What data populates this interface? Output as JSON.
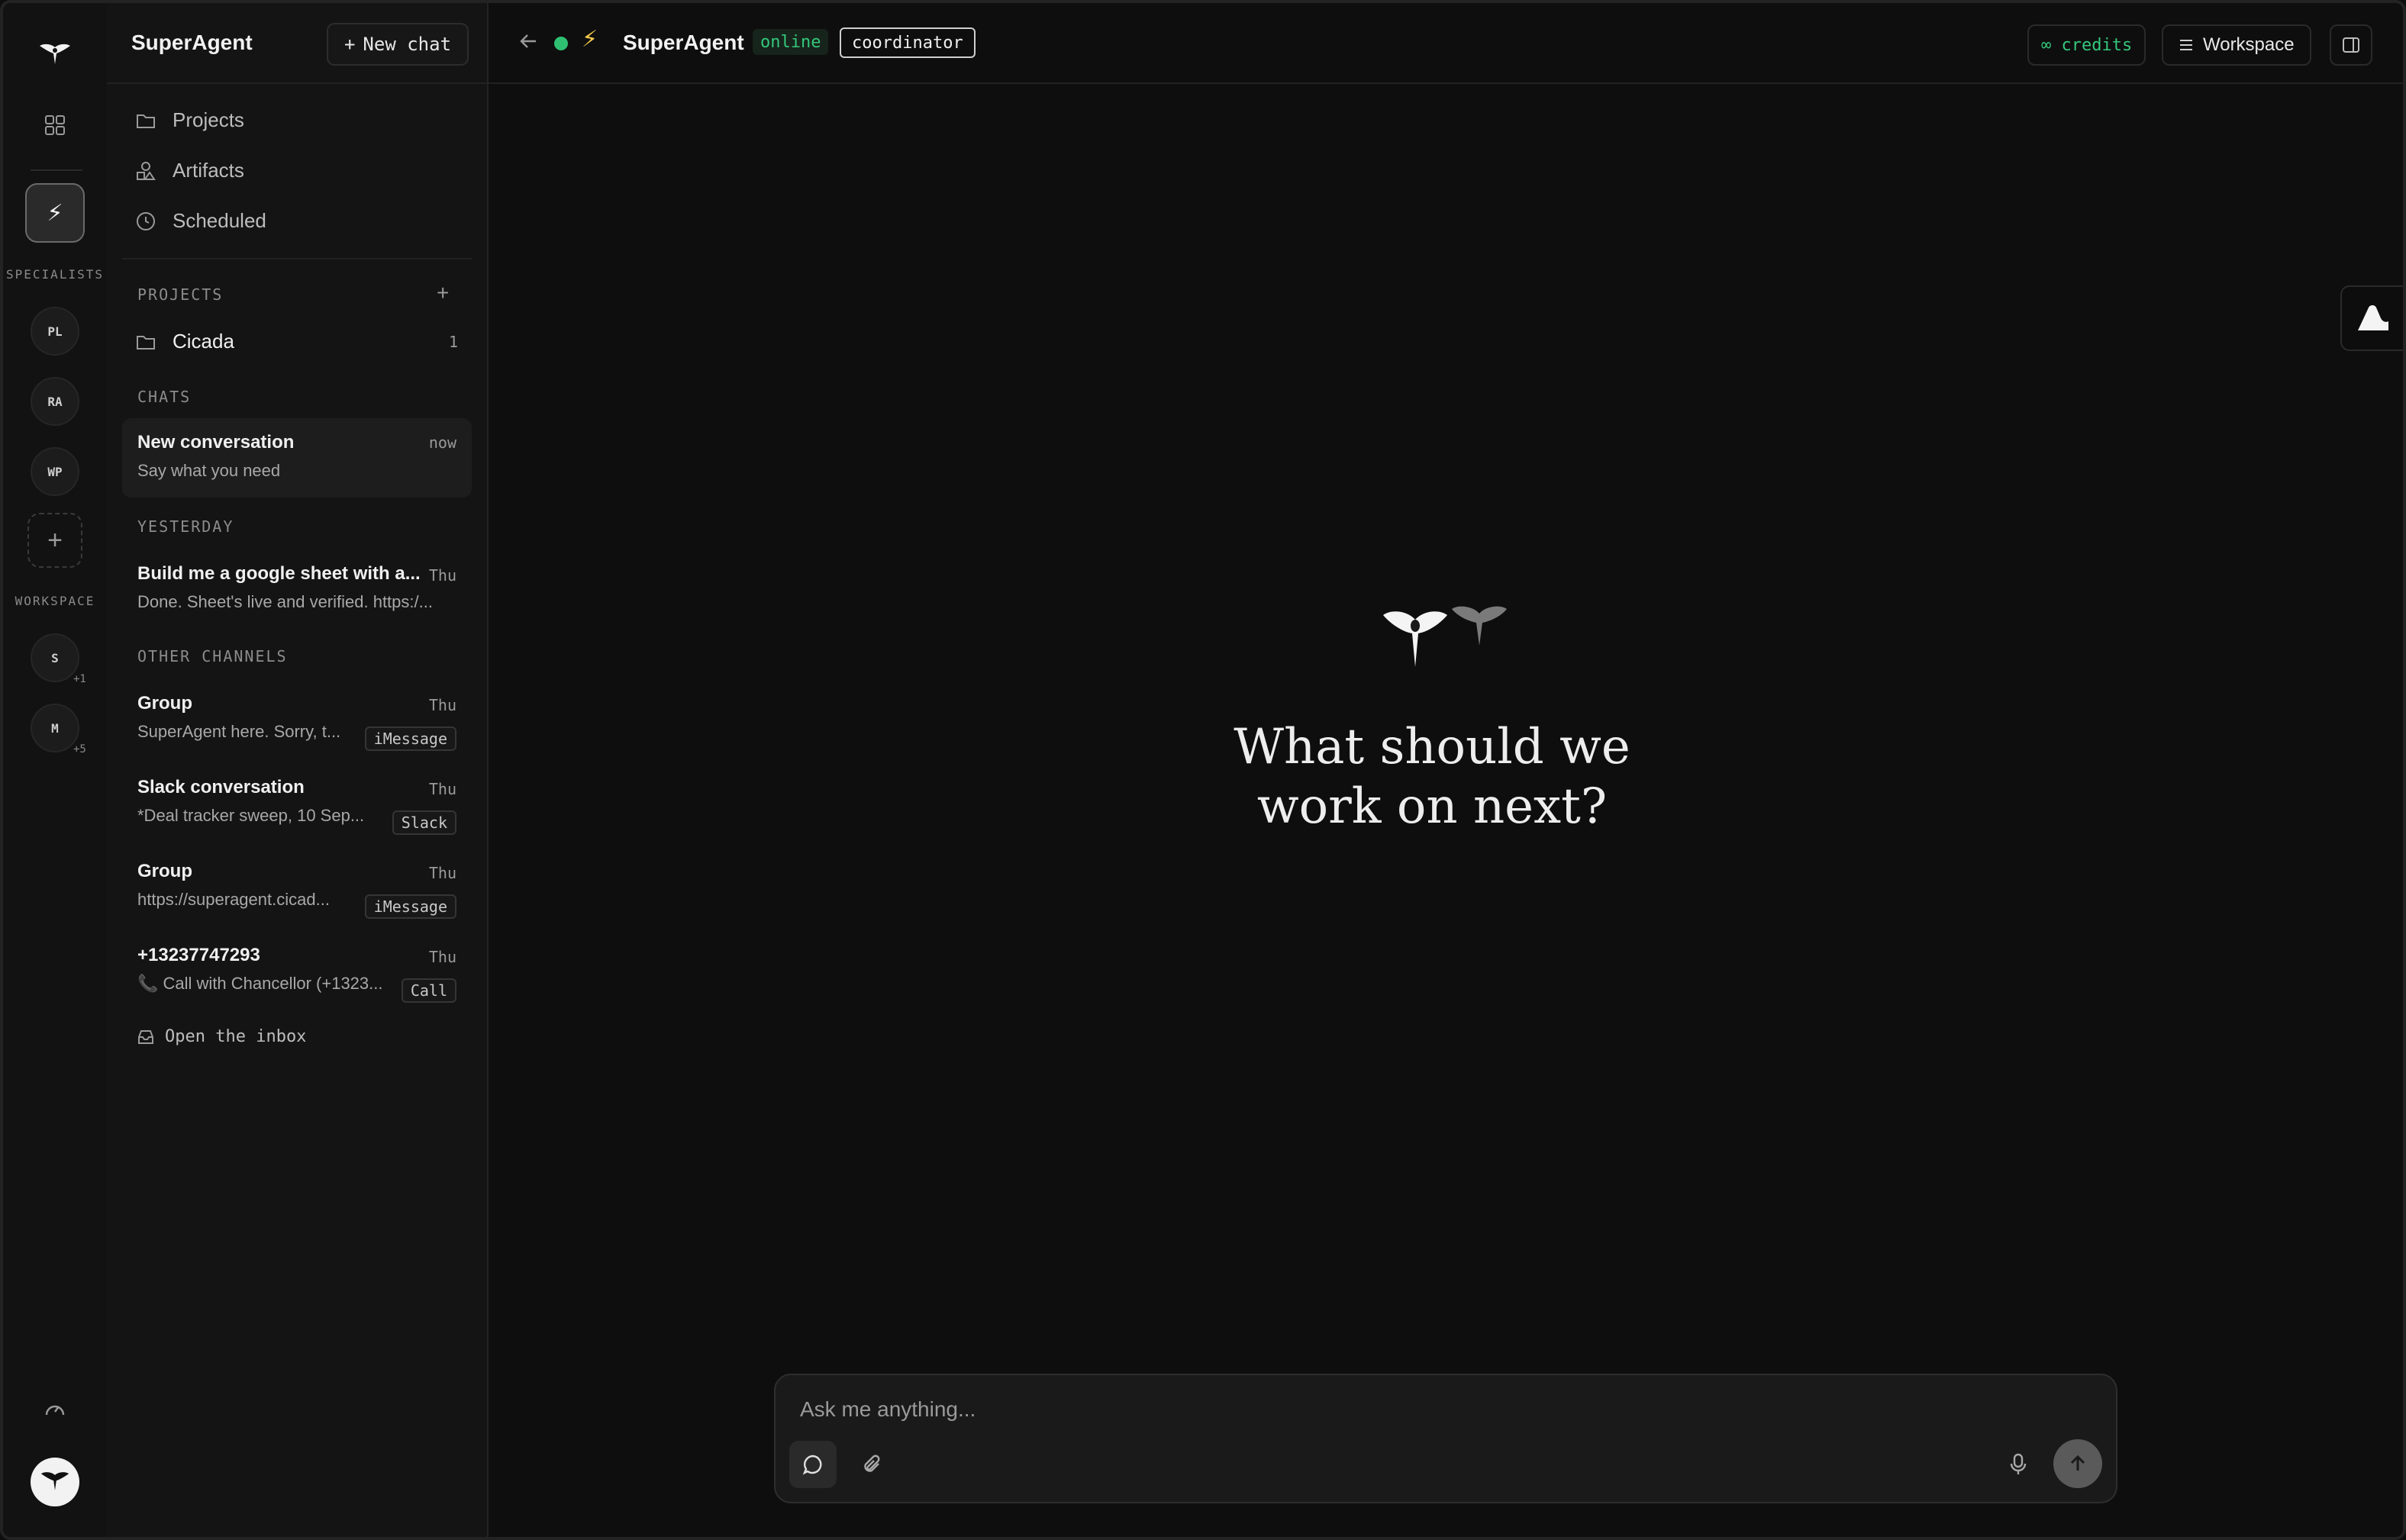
{
  "rail": {
    "specialists_label": "SPECIALISTS",
    "specialists": [
      "PL",
      "RA",
      "WP"
    ],
    "workspace_label": "WORKSPACE",
    "workspaces": [
      {
        "initial": "S",
        "extra": "+1"
      },
      {
        "initial": "M",
        "extra": "+5"
      }
    ]
  },
  "sidebar": {
    "title": "SuperAgent",
    "new_chat_label": "New chat",
    "nav": [
      {
        "label": "Projects",
        "icon": "folder-icon"
      },
      {
        "label": "Artifacts",
        "icon": "shapes-icon"
      },
      {
        "label": "Scheduled",
        "icon": "clock-icon"
      }
    ],
    "projects_label": "PROJECTS",
    "projects": [
      {
        "name": "Cicada",
        "count": "1"
      }
    ],
    "chats_label": "CHATS",
    "chats": [
      {
        "title": "New conversation",
        "time": "now",
        "preview": "Say what you need"
      }
    ],
    "yesterday_label": "YESTERDAY",
    "yesterday": [
      {
        "title": "Build me a google sheet with a...",
        "time": "Thu",
        "preview": "Done. Sheet's live and verified. https:/..."
      }
    ],
    "other_channels_label": "OTHER CHANNELS",
    "channels": [
      {
        "title": "Group",
        "time": "Thu",
        "preview": "SuperAgent here. Sorry, t...",
        "tag": "iMessage"
      },
      {
        "title": "Slack conversation",
        "time": "Thu",
        "preview": "*Deal tracker sweep, 10 Sep...",
        "tag": "Slack"
      },
      {
        "title": "Group",
        "time": "Thu",
        "preview": "https://superagent.cicad...",
        "tag": "iMessage"
      },
      {
        "title": "+13237747293",
        "time": "Thu",
        "preview": "📞 Call with Chancellor (+1323...",
        "tag": "Call"
      }
    ],
    "inbox_label": "Open the inbox"
  },
  "topbar": {
    "title": "SuperAgent",
    "status": "online",
    "role": "coordinator",
    "credits": "∞ credits",
    "workspace": "Workspace"
  },
  "main": {
    "headline_line1": "What should we",
    "headline_line2": "work on next?"
  },
  "composer": {
    "placeholder": "Ask me anything..."
  },
  "colors": {
    "accent_green": "#34c77b",
    "background": "#0e0e0e"
  }
}
